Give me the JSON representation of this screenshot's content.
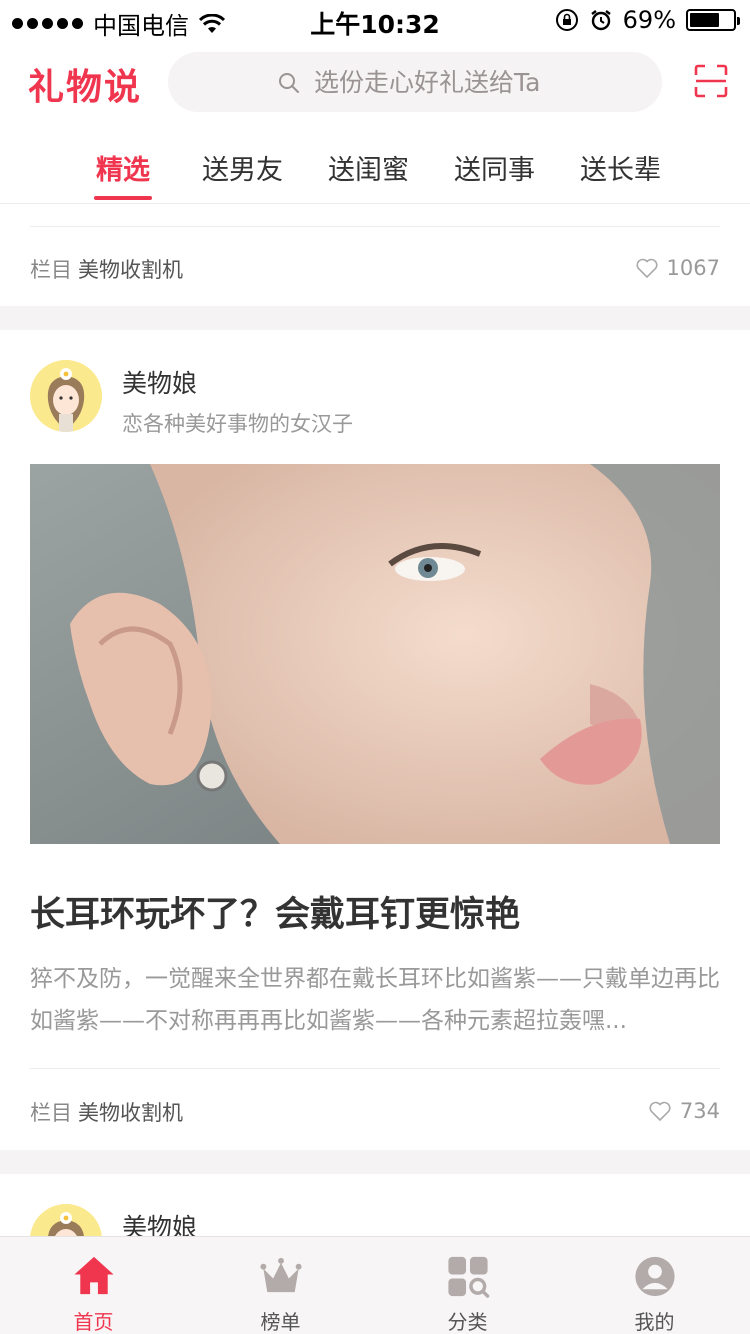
{
  "status_bar": {
    "carrier": "中国电信",
    "time": "上午10:32",
    "battery": "69%",
    "battery_level": 0.69
  },
  "header": {
    "logo": "礼物说",
    "search_placeholder": "选份走心好礼送给Ta"
  },
  "tabs": [
    {
      "label": "精选",
      "active": true
    },
    {
      "label": "送男友",
      "active": false
    },
    {
      "label": "送闺蜜",
      "active": false
    },
    {
      "label": "送同事",
      "active": false
    },
    {
      "label": "送长辈",
      "active": false
    }
  ],
  "feed": {
    "prev_card": {
      "column_prefix": "栏目",
      "column_name": "美物收割机",
      "likes": "1067"
    },
    "card": {
      "author_name": "美物娘",
      "author_bio": "恋各种美好事物的女汉子",
      "title": "长耳环玩坏了？会戴耳钉更惊艳",
      "desc": "猝不及防，一觉醒来全世界都在戴长耳环比如酱紫——只戴单边再比如酱紫——不对称再再再比如酱紫——各种元素超拉轰嘿...",
      "column_prefix": "栏目",
      "column_name": "美物收割机",
      "likes": "734"
    },
    "next_card": {
      "author_name": "美物娘"
    }
  },
  "tabbar": [
    {
      "label": "首页",
      "icon": "home-icon",
      "active": true
    },
    {
      "label": "榜单",
      "icon": "crown-icon",
      "active": false
    },
    {
      "label": "分类",
      "icon": "category-icon",
      "active": false
    },
    {
      "label": "我的",
      "icon": "profile-icon",
      "active": false
    }
  ],
  "colors": {
    "accent": "#f0354f",
    "background_gap": "#f5f3f3"
  }
}
